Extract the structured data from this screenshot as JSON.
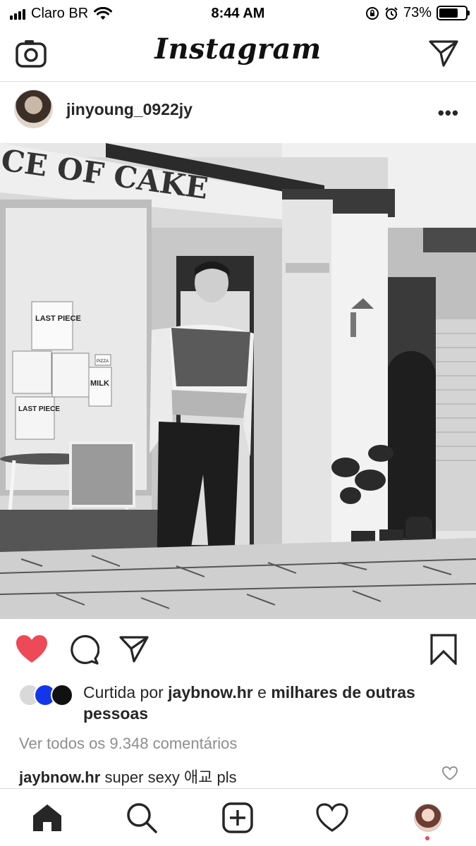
{
  "status_bar": {
    "carrier": "Claro BR",
    "time": "8:44 AM",
    "battery": "73%",
    "battery_level": 0.73,
    "icons": [
      "signal-icon",
      "wifi-icon",
      "orientation-lock-icon",
      "alarm-icon",
      "battery-icon"
    ]
  },
  "header": {
    "logo": "Instagram",
    "left_icon": "camera-icon",
    "right_icon": "direct-message-icon"
  },
  "post": {
    "username": "jinyoung_0922jy",
    "more_label": "•••",
    "photo": {
      "sign_text": "CE OF CAKE",
      "poster_1": "LAST PIECE",
      "poster_2": "MILK",
      "poster_3": "LAST PIECE",
      "poster_4": "PIZZA"
    },
    "liked_by": {
      "prefix": "Curtida por",
      "user": "jaybnow.hr",
      "middle": "e",
      "rest": "milhares de outras pessoas"
    },
    "view_comments": "Ver todos os 9.348 comentários",
    "comment": {
      "user": "jaybnow.hr",
      "text": "super sexy 애교 pls"
    }
  },
  "colors": {
    "like_red": "#ed4956",
    "text": "#262626",
    "muted": "#8e8e8e",
    "divider": "#dbdbdb"
  },
  "bottom_nav": [
    "home-icon",
    "search-icon",
    "new-post-icon",
    "activity-heart-icon",
    "profile-avatar"
  ]
}
